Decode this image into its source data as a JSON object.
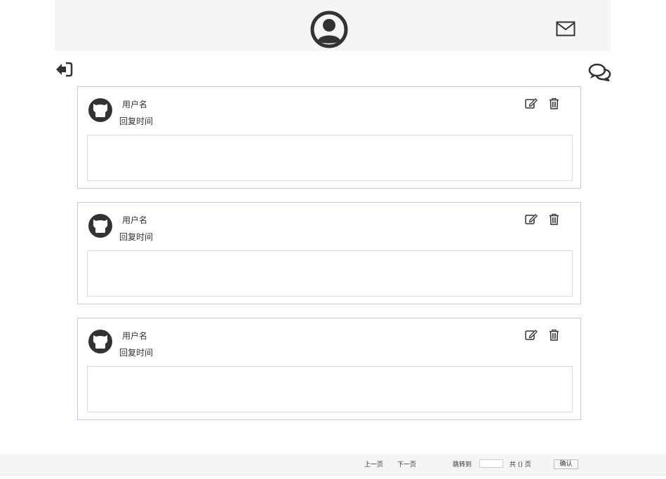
{
  "header": {
    "avatar_icon": "user-circle-icon",
    "mail_icon": "envelope-icon"
  },
  "nav": {
    "back_icon": "sign-out-icon",
    "chat_icon": "comments-icon"
  },
  "replies": [
    {
      "username": "用户名",
      "time": "回复时间",
      "content": ""
    },
    {
      "username": "用户名",
      "time": "回复时间",
      "content": ""
    },
    {
      "username": "用户名",
      "time": "回复时间",
      "content": ""
    }
  ],
  "pagination": {
    "prev": "上一页",
    "next": "下一页",
    "jump_to": "跳转到",
    "jump_value": "",
    "total": "共 () 页",
    "confirm": "确认"
  },
  "colors": {
    "header_bg": "#f5f5f5",
    "card_border": "#c8c8e6",
    "icon": "#333333"
  }
}
